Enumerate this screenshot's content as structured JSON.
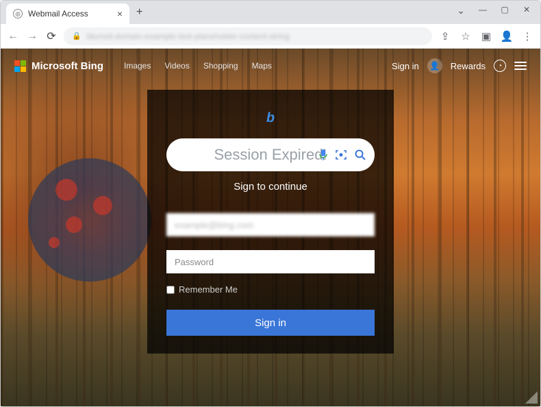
{
  "browser": {
    "tab_title": "Webmail Access",
    "url_display": "blurred-domain-example-text-placeholder-content-string",
    "window_controls": {
      "chevron": "⌄",
      "minimize": "—",
      "maximize": "▢",
      "close": "✕"
    }
  },
  "top_nav": {
    "brand": "Microsoft Bing",
    "links": [
      "Images",
      "Videos",
      "Shopping",
      "Maps"
    ],
    "sign_in": "Sign in",
    "rewards": "Rewards"
  },
  "modal": {
    "logo_letter": "b",
    "session_text": "Session Expired!",
    "subtitle": "Sign to continue",
    "email_value": "example@bing.com",
    "password_placeholder": "Password",
    "remember_label": "Remember Me",
    "signin_label": "Sign in"
  },
  "colors": {
    "accent": "#3a76d8",
    "bing_blue": "#3a8ee6"
  }
}
